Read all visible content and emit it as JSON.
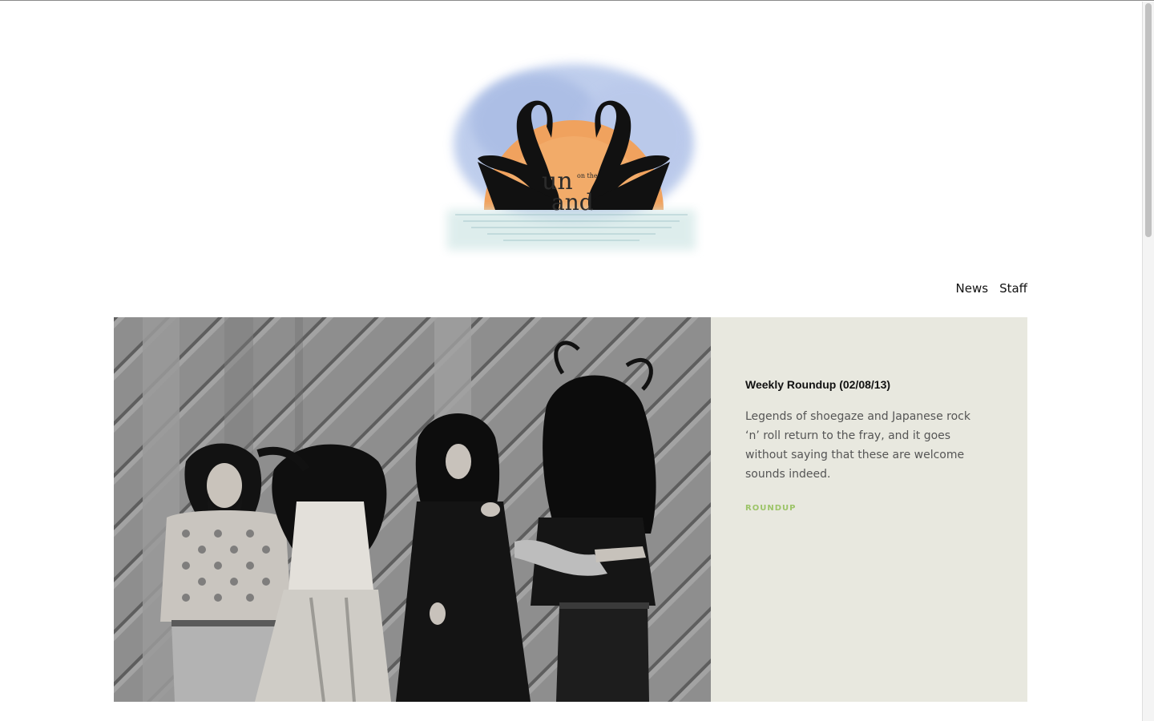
{
  "nav": {
    "items": [
      {
        "label": "News"
      },
      {
        "label": "Staff"
      }
    ]
  },
  "logo": {
    "alt": "Sun on the Sand",
    "letters_top": "un",
    "letters_small": "on the",
    "letters_bottom": "and"
  },
  "featured_post": {
    "title": "Weekly Roundup (02/08/13)",
    "excerpt": "Legends of shoegaze and Japanese rock ‘n’ roll return to the fray, and it goes without saying that these are welcome sounds indeed.",
    "tag": "ROUNDUP",
    "tag_color": "#9cc468",
    "panel_color": "#e8e8df"
  }
}
